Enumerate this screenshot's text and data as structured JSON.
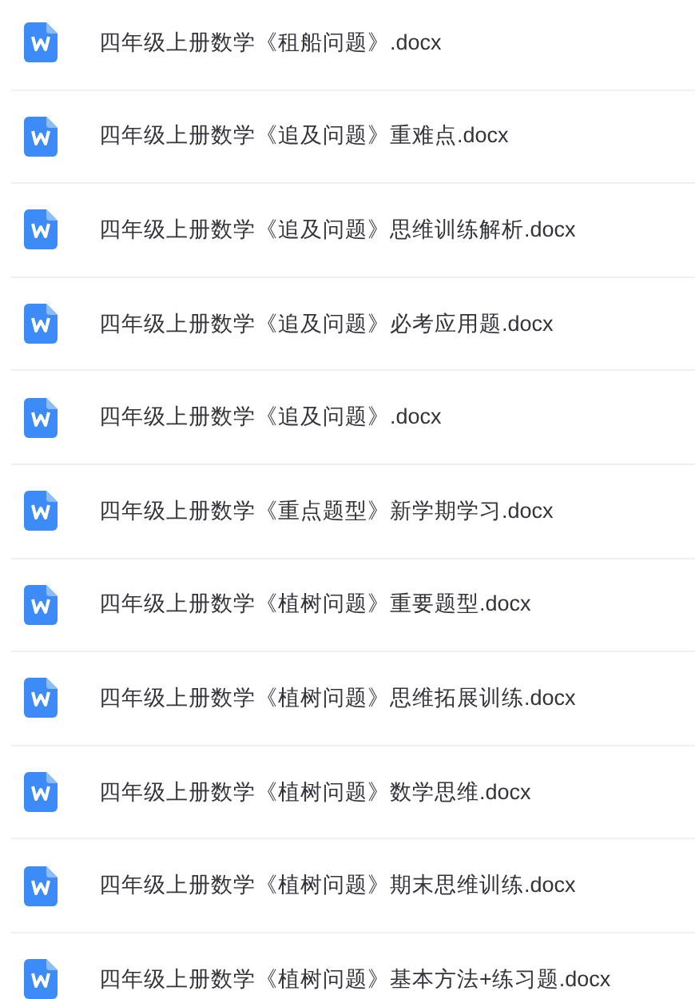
{
  "files": [
    {
      "name": "四年级上册数学《租船问题》.docx",
      "kind": "word"
    },
    {
      "name": "四年级上册数学《追及问题》重难点.docx",
      "kind": "word"
    },
    {
      "name": "四年级上册数学《追及问题》思维训练解析.docx",
      "kind": "word"
    },
    {
      "name": "四年级上册数学《追及问题》必考应用题.docx",
      "kind": "word"
    },
    {
      "name": "四年级上册数学《追及问题》.docx",
      "kind": "word"
    },
    {
      "name": "四年级上册数学《重点题型》新学期学习.docx",
      "kind": "word"
    },
    {
      "name": "四年级上册数学《植树问题》重要题型.docx",
      "kind": "word"
    },
    {
      "name": "四年级上册数学《植树问题》思维拓展训练.docx",
      "kind": "word"
    },
    {
      "name": "四年级上册数学《植树问题》数学思维.docx",
      "kind": "word"
    },
    {
      "name": "四年级上册数学《植树问题》期末思维训练.docx",
      "kind": "word"
    },
    {
      "name": "四年级上册数学《植树问题》基本方法+练习题.docx",
      "kind": "word"
    }
  ]
}
